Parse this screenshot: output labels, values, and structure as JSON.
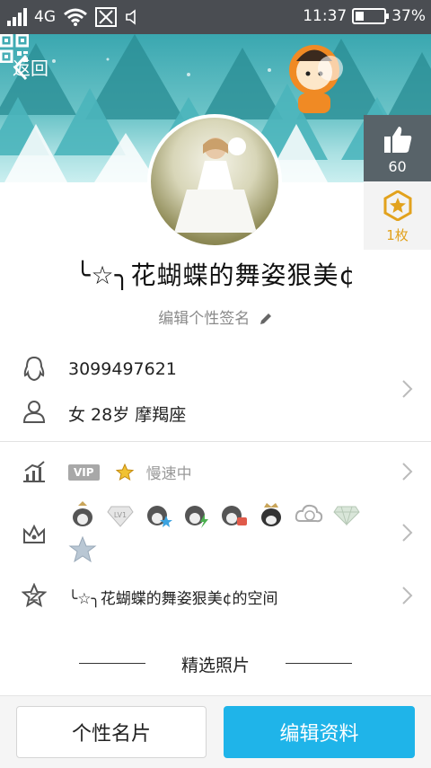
{
  "status_bar": {
    "network": "4G",
    "time": "11:37",
    "battery": "37%",
    "battery_level": 0.37
  },
  "header": {
    "back_label": "返回"
  },
  "profile": {
    "like_count": "60",
    "badge_label": "1枚",
    "nickname": "╰☆╮花蝴蝶的舞姿狠美¢",
    "signature_placeholder": "编辑个性签名"
  },
  "info": {
    "qq_number": "3099497621",
    "gender_age_sign": "女 28岁 摩羯座"
  },
  "vip": {
    "tag": "VIP",
    "status": "慢速中"
  },
  "medals": [
    "penguin-medal-icon",
    "diamond-lv1-medal-icon",
    "penguin-star-medal-icon",
    "penguin-lightning-medal-icon",
    "penguin-camera-medal-icon",
    "penguin-crown-medal-icon",
    "cloud-v-medal-icon",
    "diamond-medal-icon",
    "star-medal-icon"
  ],
  "space": {
    "label": "╰☆╮花蝴蝶的舞姿狠美¢的空间"
  },
  "photos": {
    "title": "精选照片"
  },
  "bottom": {
    "card_button": "个性名片",
    "edit_button": "编辑资料"
  },
  "colors": {
    "accent": "#1fb4e9",
    "status_bar": "#4a4d52",
    "badge_gold": "#e2a21d"
  }
}
